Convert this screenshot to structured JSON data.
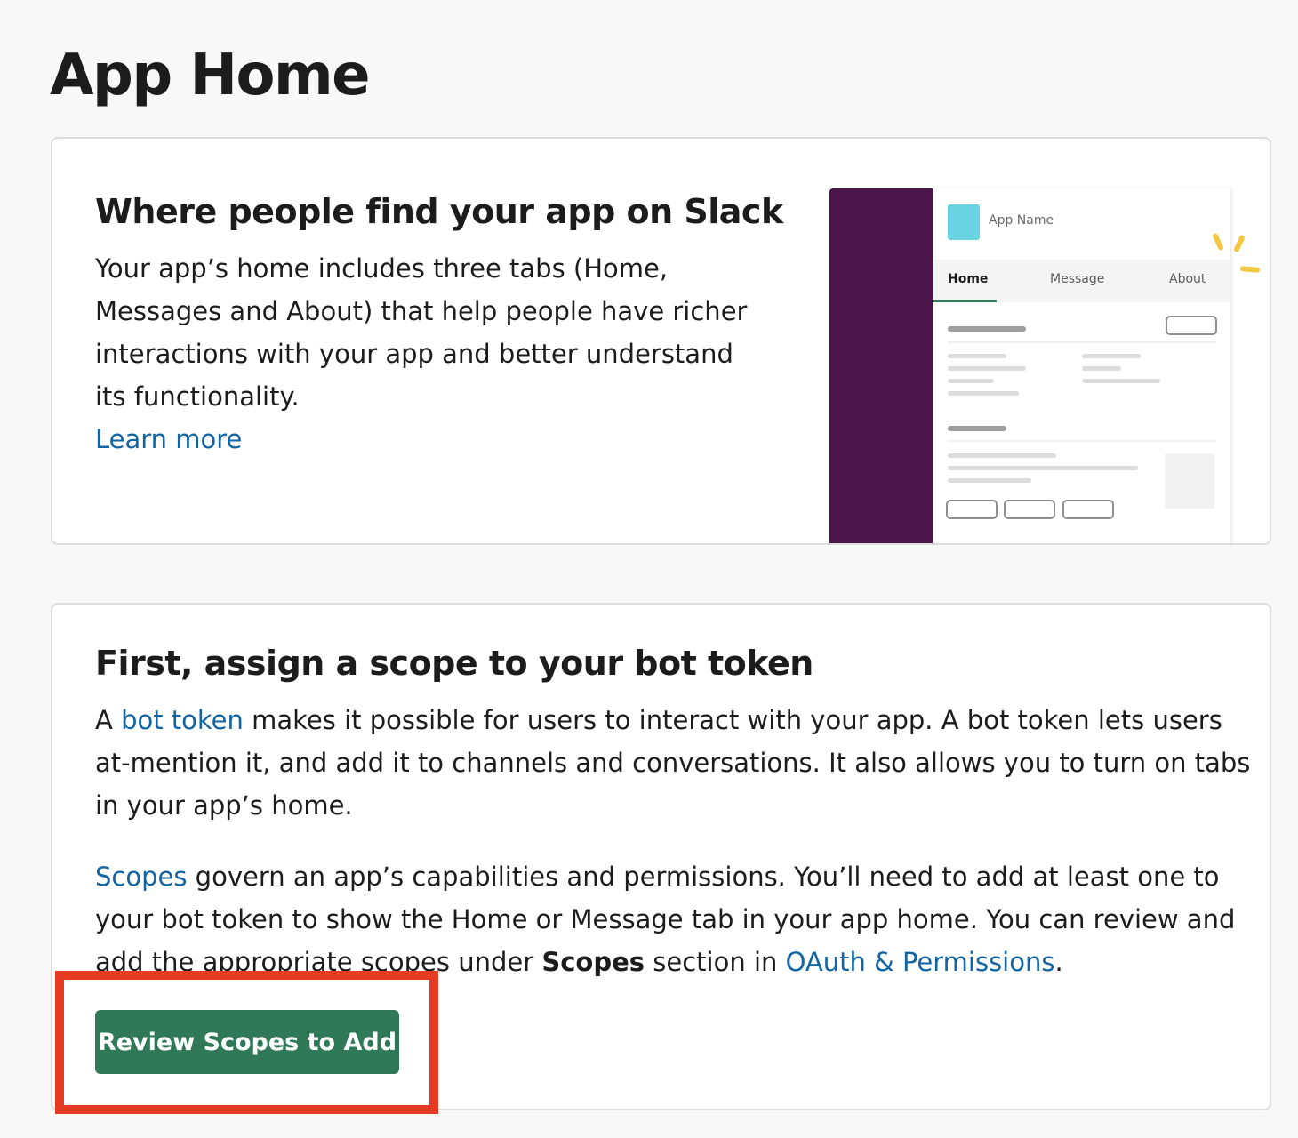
{
  "page": {
    "title": "App Home"
  },
  "card_where": {
    "heading": "Where people find your app on Slack",
    "body": "Your app’s home includes three tabs (Home, Messages and About) that help people have richer interactions with your app and better understand its functionality.",
    "learn_more": "Learn more"
  },
  "mock": {
    "app_name": "App Name",
    "tabs": [
      "Home",
      "Message",
      "About"
    ],
    "active_tab": "Home",
    "sidebar_color": "#4a154b",
    "icon_color": "#6ad3e2"
  },
  "card_scope": {
    "heading": "First, assign a scope to your bot token",
    "p1_prefix": "A ",
    "p1_link": "bot token",
    "p1_suffix": " makes it possible for users to interact with your app. A bot token lets users at-mention it, and add it to channels and conversations. It also allows you to turn on tabs in your app’s home.",
    "p2_link": "Scopes",
    "p2_mid": " govern an app’s capabilities and permissions. You’ll need to add at least one to your bot token to show the Home or Message tab in your app home. You can review and add the appropriate scopes under ",
    "p2_bold": "Scopes",
    "p2_mid2": " section in ",
    "p2_link2": "OAuth & Permissions",
    "p2_end": ".",
    "button_label": "Review Scopes to Add",
    "button_color": "#2f7959"
  },
  "highlight_color": "#e63a23"
}
